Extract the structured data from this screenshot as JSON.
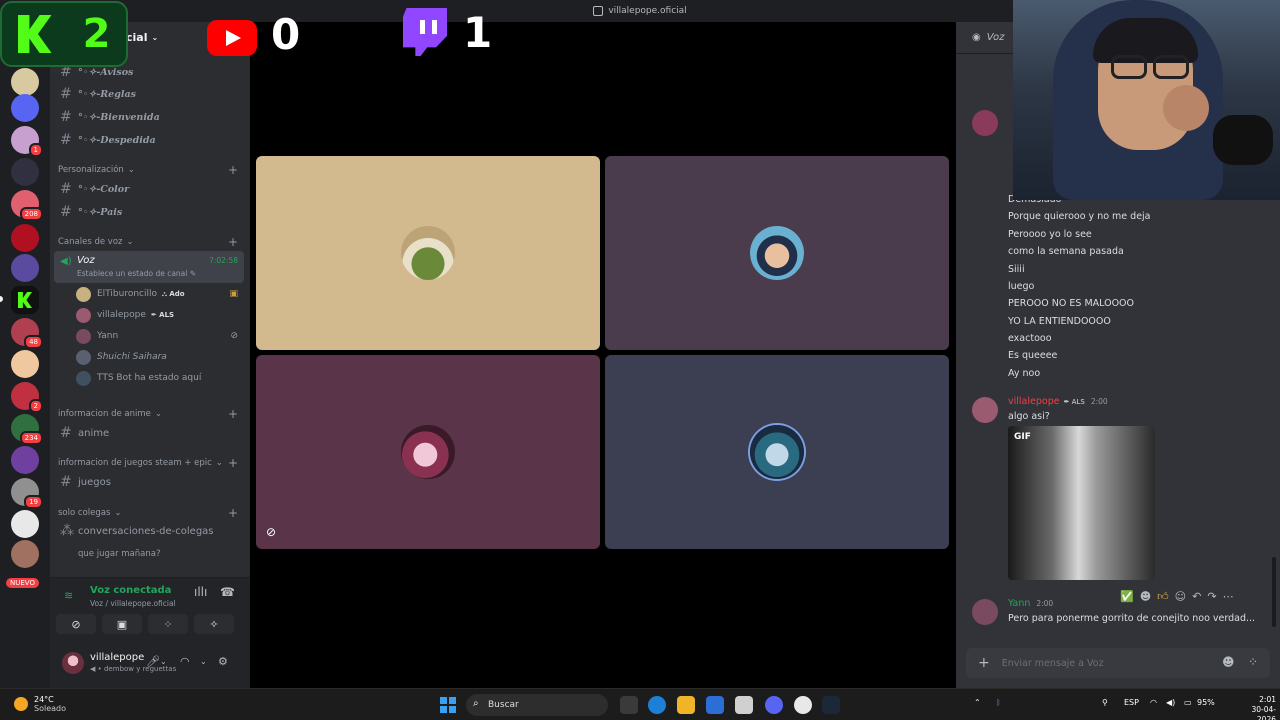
{
  "window": {
    "title": "villalepope.oficial"
  },
  "overlay": {
    "kick_count": "2",
    "youtube_count": "0",
    "twitch_count": "1"
  },
  "server": {
    "name": "cial"
  },
  "channels": {
    "avisos": "°◦✧-Avisos",
    "reglas": "°◦✧-Reglas",
    "bienvenida": "°◦✧-Bienvenida",
    "despedida": "°◦✧-Despedida",
    "cat_personalizacion": "Personalización",
    "color": "°◦✧-Color",
    "pais": "°◦✧-Pais",
    "cat_voz": "Canales de voz",
    "voz_name": "Voz",
    "voz_status": "Establece un estado de canal",
    "voz_timer": "7:02:58",
    "cat_anime": "informacion de anime",
    "anime": "anime",
    "cat_juegos": "informacion de juegos steam + epic",
    "juegos": "juegos",
    "cat_colegas": "solo colegas",
    "conversaciones": "conversaciones-de-colegas",
    "thread": "que jugar mañana?"
  },
  "voice_users": [
    {
      "name": "ElTiburoncillo",
      "tag": "Ado"
    },
    {
      "name": "villalepope",
      "tag": "ALS"
    },
    {
      "name": "Yann",
      "tag": ""
    },
    {
      "name": "Shuichi Saihara",
      "tag": ""
    },
    {
      "name": "TTS Bot ha estado aquí",
      "tag": ""
    }
  ],
  "voice_panel": {
    "title": "Voz conectada",
    "subtitle": "Voz / villalepope.oficial"
  },
  "user_panel": {
    "name": "villalepope",
    "status": "dembow y reguettas"
  },
  "server_badges": {
    "b1": "1",
    "b2": "208",
    "b3": "48",
    "b4": "2",
    "b5": "234",
    "b6": "19",
    "new": "NUEVO"
  },
  "chat": {
    "channel": "Voz",
    "lines": [
      "Demasiado",
      "Porque quierooo y no me deja",
      "Peroooo yo lo see",
      "como la semana pasada",
      "Siiii",
      "luego",
      "PEROOO NO ES MALOOOO",
      "YO LA ENTIENDOOOO",
      "exactooo",
      "Es queeee",
      "Ay noo"
    ],
    "msg2": {
      "author": "villalepope",
      "tag": "ALS",
      "time": "2:00",
      "text": "algo asi?",
      "gif_label": "GIF"
    },
    "msg3": {
      "author": "Yann",
      "time": "2:00",
      "text": "Pero para ponerme gorrito de conejito noo verdad..."
    },
    "input_placeholder": "Enviar mensaje a Voz"
  },
  "taskbar": {
    "temp": "24°C",
    "weather": "Soleado",
    "search": "Buscar",
    "lang": "ESP",
    "battery": "95%",
    "time": "2:01",
    "date": "30-04-2026"
  },
  "colors": {
    "accent_green": "#23a55a",
    "discord_bg": "#313338",
    "kick_green": "#53fc18",
    "twitch": "#9146ff",
    "youtube": "#ff0000"
  }
}
